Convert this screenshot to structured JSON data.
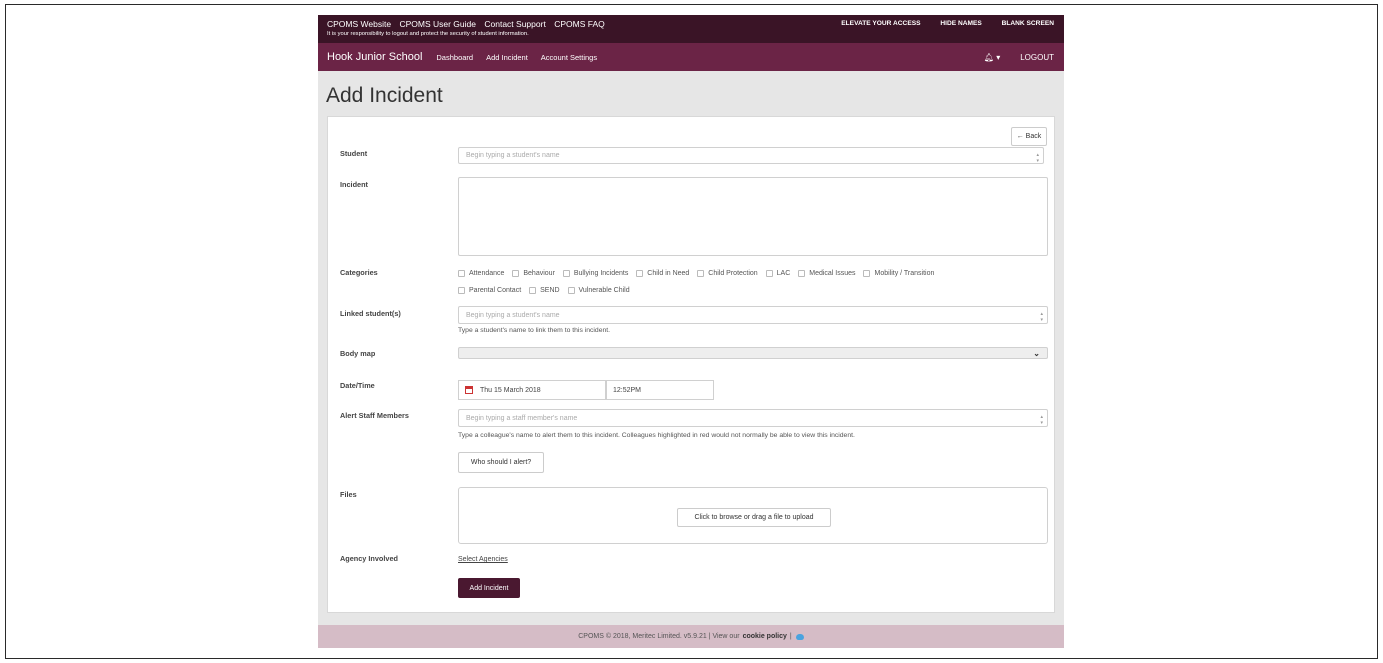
{
  "topbar": {
    "links": [
      "CPOMS Website",
      "CPOMS User Guide",
      "Contact Support",
      "CPOMS FAQ"
    ],
    "notice": "It is your responsibility to logout and protect the security of student information.",
    "right": [
      "ELEVATE YOUR ACCESS",
      "HIDE NAMES",
      "BLANK SCREEN"
    ]
  },
  "navbar": {
    "brand": "Hook Junior School",
    "items": [
      "Dashboard",
      "Add Incident",
      "Account Settings"
    ],
    "bell_caret": "▾",
    "logout": "LOGOUT"
  },
  "page": {
    "title": "Add Incident"
  },
  "form": {
    "back": "← Back",
    "student": {
      "label": "Student",
      "placeholder": "Begin typing a student's name"
    },
    "incident": {
      "label": "Incident",
      "value": ""
    },
    "categories": {
      "label": "Categories",
      "options": [
        "Attendance",
        "Behaviour",
        "Bullying Incidents",
        "Child in Need",
        "Child Protection",
        "LAC",
        "Medical Issues",
        "Mobility / Transition",
        "Parental Contact",
        "SEND",
        "Vulnerable Child"
      ]
    },
    "linked": {
      "label": "Linked student(s)",
      "placeholder": "Begin typing a student's name",
      "help": "Type a student's name to link them to this incident."
    },
    "body_map": {
      "label": "Body map",
      "value": ""
    },
    "datetime": {
      "label": "Date/Time",
      "date": "Thu 15 March 2018",
      "time": "12:52PM"
    },
    "alert": {
      "label": "Alert Staff Members",
      "placeholder": "Begin typing a staff member's name",
      "help": "Type a colleague's name to alert them to this incident. Colleagues highlighted in red would not normally be able to view this incident.",
      "who_button": "Who should I alert?"
    },
    "files": {
      "label": "Files",
      "upload": "Click to browse or drag a file to upload"
    },
    "agency": {
      "label": "Agency Involved",
      "link": "Select Agencies"
    },
    "submit": "Add Incident"
  },
  "footer": {
    "text": "CPOMS © 2018, Meritec Limited. v5.9.21 | View our",
    "link": "cookie policy",
    "sep": "|"
  },
  "colors": {
    "topbar": "#3a1426",
    "navbar": "#6b2446",
    "primary": "#4a1830",
    "footer": "#d5bcc6"
  }
}
